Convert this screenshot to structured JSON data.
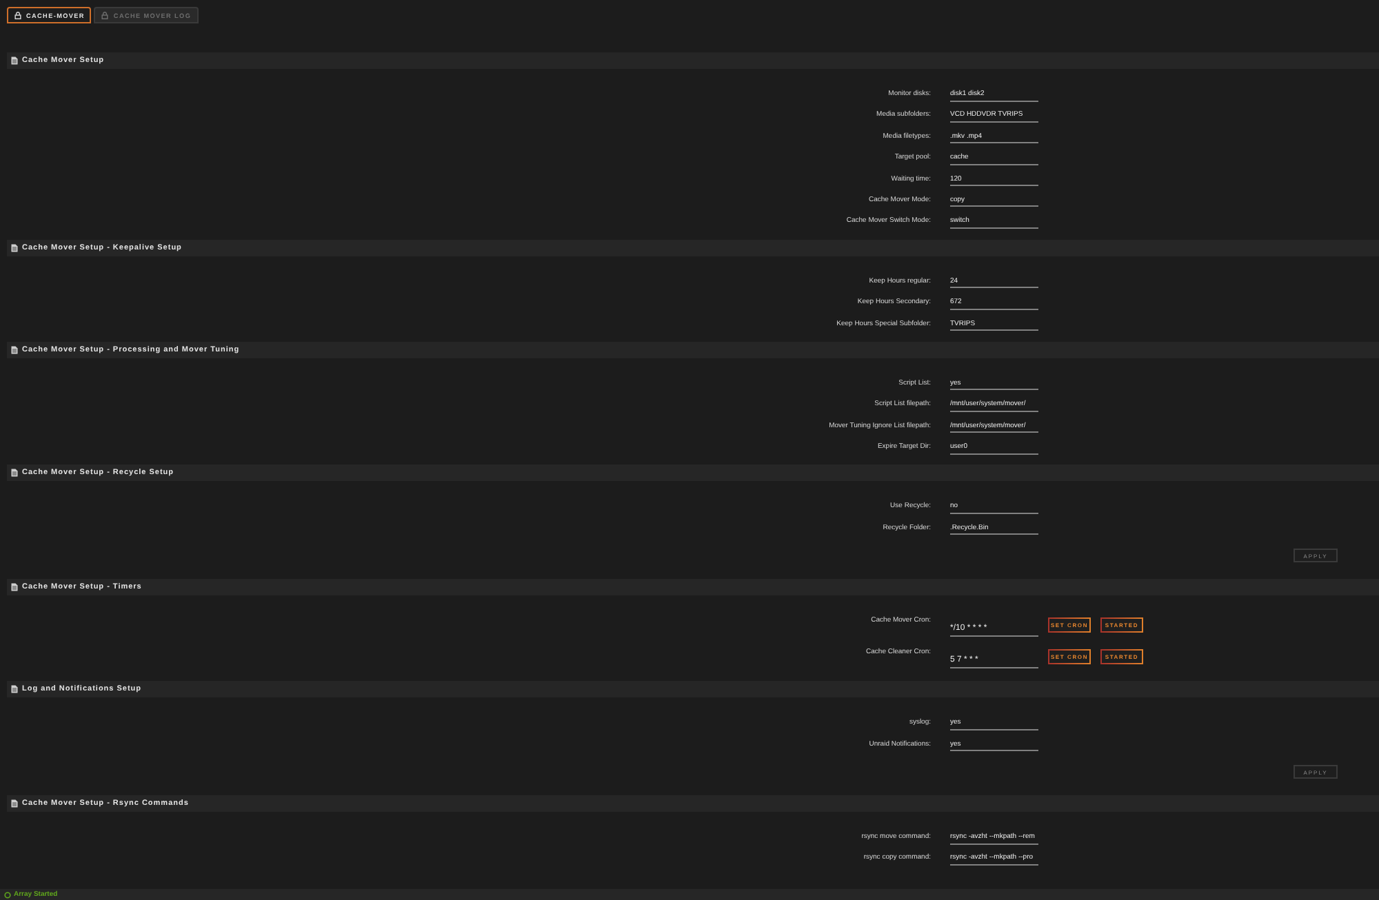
{
  "tabs": [
    {
      "label": "CACHE-MOVER",
      "selected": true
    },
    {
      "label": "CACHE MOVER LOG",
      "selected": false
    }
  ],
  "sections": [
    {
      "title": "Cache Mover Setup",
      "fields": [
        {
          "label": "Monitor disks:",
          "value": "disk1 disk2"
        },
        {
          "label": "Media subfolders:",
          "value": "VCD HDDVDR TVRIPS"
        },
        {
          "label": "Media filetypes:",
          "value": ".mkv .mp4"
        },
        {
          "label": "Target pool:",
          "value": "cache"
        },
        {
          "label": "Waiting time:",
          "value": "120"
        },
        {
          "label": "Cache Mover Mode:",
          "value": "copy"
        },
        {
          "label": "Cache Mover Switch Mode:",
          "value": "switch"
        }
      ]
    },
    {
      "title": "Cache Mover Setup - Keepalive Setup",
      "fields": [
        {
          "label": "Keep Hours regular:",
          "value": "24"
        },
        {
          "label": "Keep Hours Secondary:",
          "value": "672"
        },
        {
          "label": "Keep Hours Special Subfolder:",
          "value": "TVRIPS"
        }
      ]
    },
    {
      "title": "Cache Mover Setup - Processing and Mover Tuning",
      "fields": [
        {
          "label": "Script List:",
          "value": "yes"
        },
        {
          "label": "Script List filepath:",
          "value": "/mnt/user/system/mover/"
        },
        {
          "label": "Mover Tuning Ignore List filepath:",
          "value": "/mnt/user/system/mover/"
        },
        {
          "label": "Expire Target Dir:",
          "value": "user0"
        }
      ]
    },
    {
      "title": "Cache Mover Setup - Recycle Setup",
      "fields": [
        {
          "label": "Use Recycle:",
          "value": "no"
        },
        {
          "label": "Recycle Folder:",
          "value": ".Recycle.Bin"
        }
      ],
      "apply": {
        "label": "APPLY",
        "disabled": true
      }
    },
    {
      "title": "Cache Mover Setup - Timers",
      "fields": [
        {
          "label": "Cache Mover Cron:",
          "value": "*/10 * * * *",
          "buttons": [
            {
              "label": "SET CRON"
            },
            {
              "label": "STARTED"
            }
          ]
        },
        {
          "label": "Cache Cleaner Cron:",
          "value": "5 7 * * *",
          "buttons": [
            {
              "label": "SET CRON"
            },
            {
              "label": "STARTED"
            }
          ]
        }
      ]
    },
    {
      "title": "Log and Notifications Setup",
      "fields": [
        {
          "label": "syslog:",
          "value": "yes"
        },
        {
          "label": "Unraid Notifications:",
          "value": "yes"
        }
      ],
      "apply": {
        "label": "APPLY",
        "disabled": true
      }
    },
    {
      "title": "Cache Mover Setup - Rsync Commands",
      "fields": [
        {
          "label": "rsync move command:",
          "value": "rsync -avzht --mkpath --rem"
        },
        {
          "label": "rsync copy command:",
          "value": "rsync -avzht --mkpath --pro"
        }
      ]
    }
  ],
  "status_bar": {
    "text": "Array Started"
  }
}
